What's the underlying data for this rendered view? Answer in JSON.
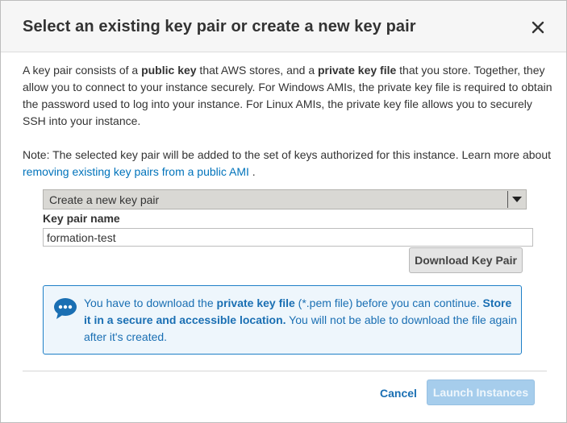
{
  "dialog": {
    "title": "Select an existing key pair or create a new key pair"
  },
  "intro": {
    "t1": "A key pair consists of a ",
    "b1": "public key",
    "t2": " that AWS stores, and a ",
    "b2": "private key file",
    "t3": " that you store. Together, they allow you to connect to your instance securely. For Windows AMIs, the private key file is required to obtain the password used to log into your instance. For Linux AMIs, the private key file allows you to securely SSH into your instance."
  },
  "note": {
    "text": "Note: The selected key pair will be added to the set of keys authorized for this instance. Learn more about ",
    "link": "removing existing key pairs from a public AMI",
    "suffix": " ."
  },
  "keypair_select": {
    "value": "Create a new key pair"
  },
  "keypair_name": {
    "label": "Key pair name",
    "value": "formation-test"
  },
  "download_button": "Download Key Pair",
  "info": {
    "t1": "You have to download the ",
    "b1": "private key file",
    "t2": " (*.pem file) before you can continue. ",
    "b2": "Store it in a secure and accessible location.",
    "t3": " You will not be able to download the file again after it's created."
  },
  "footer": {
    "cancel": "Cancel",
    "launch": "Launch Instances"
  },
  "colors": {
    "link": "#0073bb",
    "info_border": "#1e7fc7",
    "info_bg": "#eef6fc",
    "primary_disabled": "#a6cdec"
  },
  "icons": {
    "close": "close-icon",
    "select_arrow": "chevron-down-icon",
    "info": "chat-bubble-icon"
  }
}
